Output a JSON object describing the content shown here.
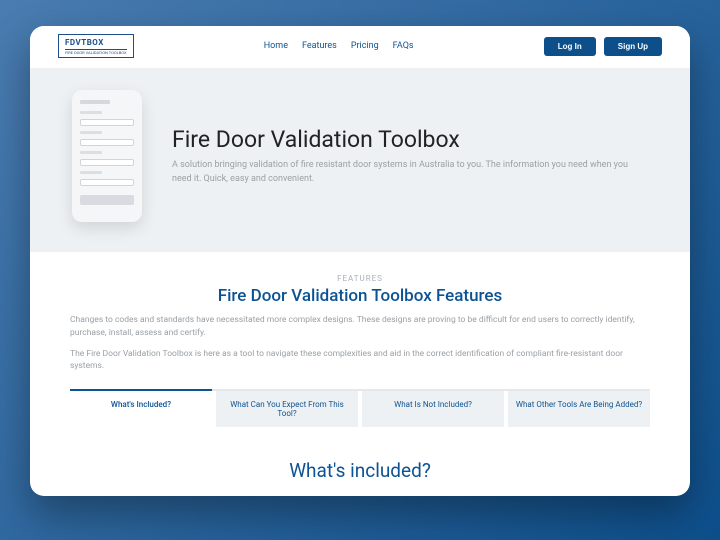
{
  "logo": {
    "main": "FDVTBOX",
    "sub": "FIRE DOOR VALIDATION TOOLBOX"
  },
  "nav": {
    "home": "Home",
    "features": "Features",
    "pricing": "Pricing",
    "faqs": "FAQs"
  },
  "auth": {
    "login": "Log In",
    "signup": "Sign Up"
  },
  "hero": {
    "title": "Fire Door Validation Toolbox",
    "subtitle": "A solution bringing validation of fire resistant door systems in Australia to you. The information you need when you need it. Quick, easy and convenient."
  },
  "features": {
    "over": "FEATURES",
    "heading": "Fire Door Validation Toolbox Features",
    "p1": "Changes to codes and standards have necessitated more complex designs. These designs are proving to be difficult for end users to correctly identify, purchase, install, assess and certify.",
    "p2": "The Fire Door Validation Toolbox is here as a tool to navigate these complexities and aid in the correct identification of compliant fire-resistant door systems.",
    "tabs": {
      "t1": "What's Included?",
      "t2": "What Can You Expect From This Tool?",
      "t3": "What Is Not Included?",
      "t4": "What Other Tools Are Being Added?"
    }
  },
  "section_heading": "What's included?"
}
